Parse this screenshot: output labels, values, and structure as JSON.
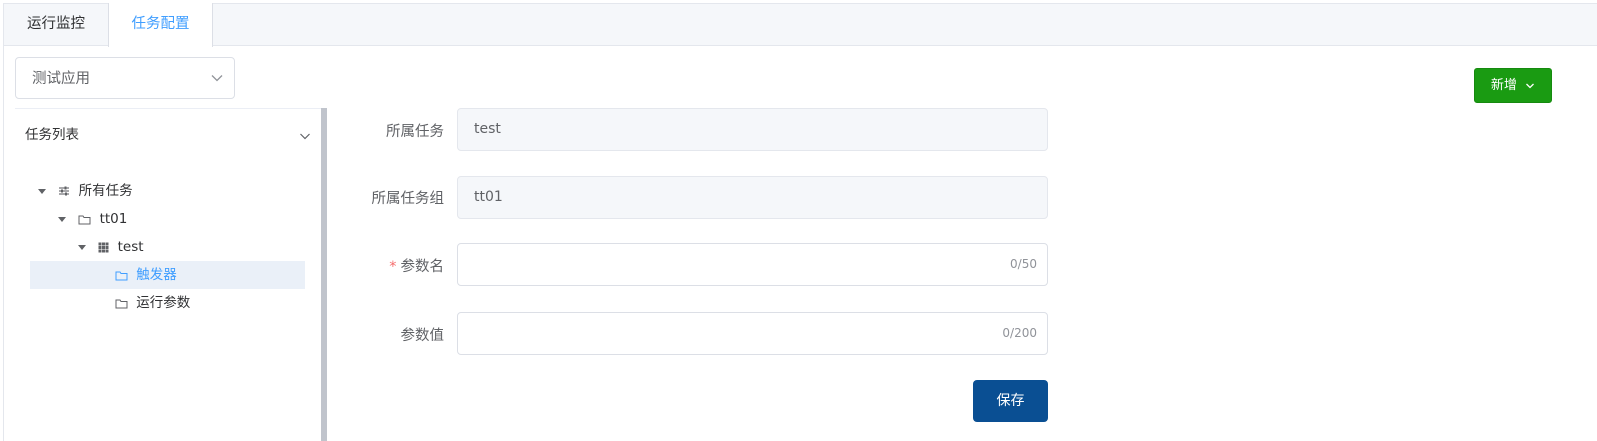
{
  "tabs": [
    {
      "label": "运行监控",
      "active": false
    },
    {
      "label": "任务配置",
      "active": true
    }
  ],
  "app_select": {
    "value": "测试应用",
    "icon": "chevron-down-icon"
  },
  "toolbar": {
    "new_label": "新增",
    "new_icon": "chevron-down-icon",
    "new_color": "#1a9b12"
  },
  "tree": {
    "title": "任务列表",
    "nodes": [
      {
        "label": "所有任务",
        "icon": "sliders-icon",
        "level": 0,
        "expanded": true
      },
      {
        "label": "tt01",
        "icon": "folder-icon",
        "level": 1,
        "expanded": true
      },
      {
        "label": "test",
        "icon": "grid-icon",
        "level": 2,
        "expanded": true
      },
      {
        "label": "触发器",
        "icon": "folder-icon",
        "level": 3,
        "selected": true
      },
      {
        "label": "运行参数",
        "icon": "folder-icon",
        "level": 3,
        "selected": false
      }
    ]
  },
  "form": {
    "task_label": "所属任务",
    "task_value": "test",
    "group_label": "所属任务组",
    "group_value": "tt01",
    "param_name_label": "参数名",
    "param_name_required_mark": "*",
    "param_name_value": "",
    "param_name_count": "0/50",
    "param_value_label": "参数值",
    "param_value_value": "",
    "param_value_count": "0/200",
    "save_label": "保存"
  },
  "colors": {
    "accent": "#409eff",
    "save": "#0a4f93",
    "required": "#f56c6c"
  }
}
